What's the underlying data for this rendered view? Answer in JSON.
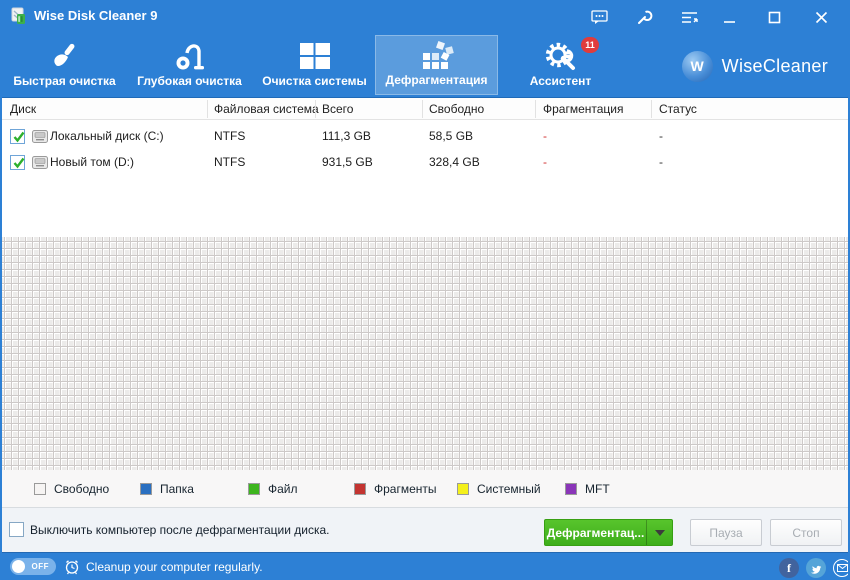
{
  "titlebar": {
    "title": "Wise Disk Cleaner 9"
  },
  "toolbar": {
    "tabs": [
      {
        "label": "Быстрая очистка"
      },
      {
        "label": "Глубокая очистка"
      },
      {
        "label": "Очистка системы"
      },
      {
        "label": "Дефрагментация",
        "selected": true
      },
      {
        "label": "Ассистент",
        "badge": "11"
      }
    ],
    "brand": {
      "initial": "W",
      "name": "WiseCleaner"
    }
  },
  "table": {
    "columns": [
      "Диск",
      "Файловая система",
      "Всего",
      "Свободно",
      "Фрагментация",
      "Статус"
    ],
    "rows": [
      {
        "name": "Локальный диск (C:)",
        "fs": "NTFS",
        "total": "111,3 GB",
        "free": "58,5 GB",
        "frag": "-",
        "status": "-"
      },
      {
        "name": "Новый том (D:)",
        "fs": "NTFS",
        "total": "931,5 GB",
        "free": "328,4 GB",
        "frag": "-",
        "status": "-"
      }
    ]
  },
  "legend": {
    "items": [
      {
        "label": "Свободно",
        "color": "#f6f4f3"
      },
      {
        "label": "Папка",
        "color": "#2a6fc0"
      },
      {
        "label": "Файл",
        "color": "#3db51e"
      },
      {
        "label": "Фрагменты",
        "color": "#c33431"
      },
      {
        "label": "Системный",
        "color": "#f4f01b"
      },
      {
        "label": "MFT",
        "color": "#8a35b8"
      }
    ]
  },
  "footer": {
    "shutdown_label": "Выключить компьютер после дефрагментации диска.",
    "defrag_button": "Дефрагментац...",
    "pause_button": "Пауза",
    "stop_button": "Стоп"
  },
  "statusbar": {
    "toggle_state": "OFF",
    "message": "Cleanup your computer regularly.",
    "social_f": "f"
  },
  "colors": {
    "accent": "#2d80d5",
    "selected_tab": "#5b9cdd",
    "action_green": "#45b41f",
    "badge_red": "#e03c3c"
  }
}
